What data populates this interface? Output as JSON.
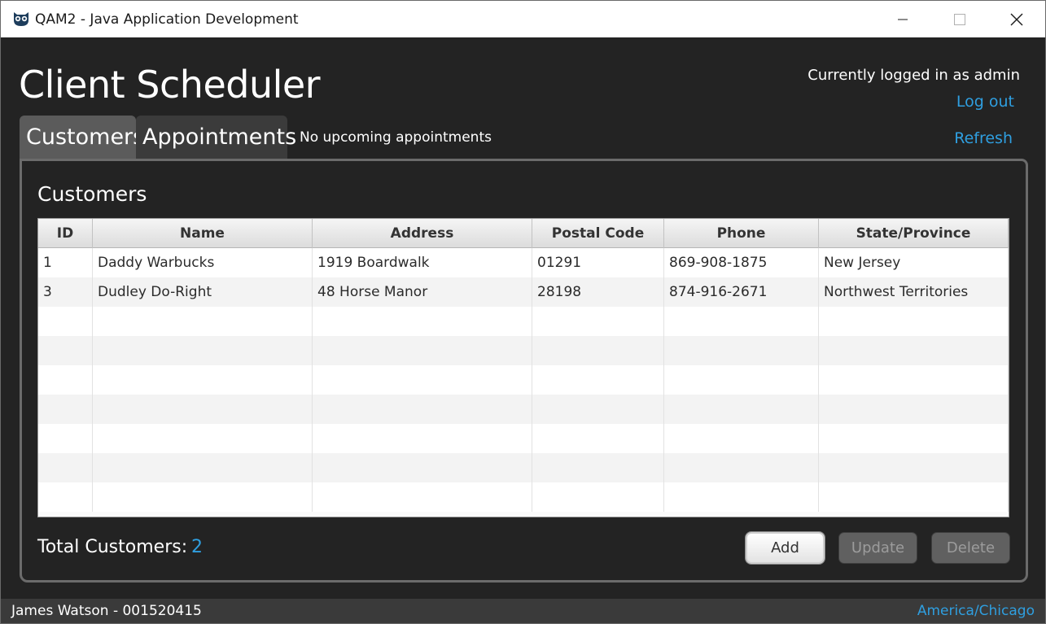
{
  "window": {
    "title": "QAM2 - Java Application Development",
    "app_icon": "owl-icon",
    "controls": [
      "minimize-icon",
      "maximize-icon",
      "close-icon"
    ]
  },
  "header": {
    "app_title": "Client Scheduler",
    "logged_in_text": "Currently logged in as admin",
    "logout_label": "Log out",
    "refresh_label": "Refresh"
  },
  "tabs": [
    {
      "label": "Customers",
      "selected": true
    },
    {
      "label": "Appointments",
      "selected": false
    }
  ],
  "upcoming_text": "No upcoming appointments",
  "panel": {
    "title": "Customers",
    "columns": [
      "ID",
      "Name",
      "Address",
      "Postal Code",
      "Phone",
      "State/Province"
    ],
    "rows": [
      [
        "1",
        "Daddy Warbucks",
        "1919 Boardwalk",
        "01291",
        "869-908-1875",
        "New Jersey"
      ],
      [
        "3",
        "Dudley Do-Right",
        "48 Horse Manor",
        "28198",
        "874-916-2671",
        "Northwest Territories"
      ]
    ],
    "total_label": "Total Customers:",
    "total_count": "2",
    "buttons": {
      "add": "Add",
      "update": "Update",
      "delete": "Delete"
    }
  },
  "statusbar": {
    "user": "James Watson - 001520415",
    "timezone": "America/Chicago"
  },
  "colors": {
    "background": "#232323",
    "accent_link": "#2f9fe0",
    "tab_selected": "#5b5b5b",
    "tab_unselected": "#3b3b3b"
  }
}
